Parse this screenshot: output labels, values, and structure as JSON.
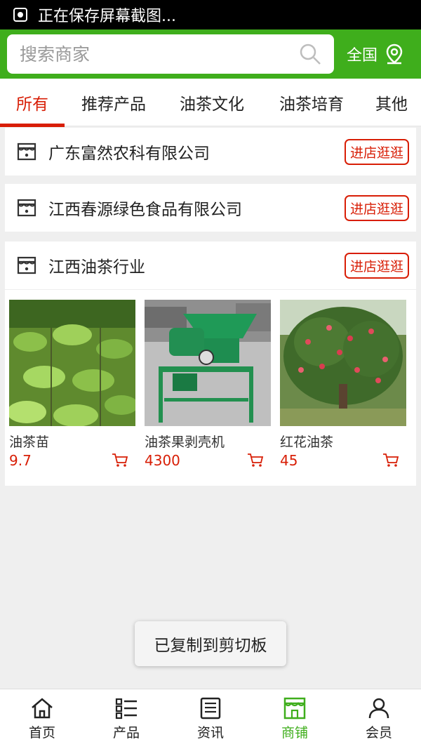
{
  "status": {
    "text": "正在保存屏幕截图..."
  },
  "search": {
    "placeholder": "搜索商家",
    "region": "全国"
  },
  "tabs": [
    {
      "label": "所有"
    },
    {
      "label": "推荐产品"
    },
    {
      "label": "油茶文化"
    },
    {
      "label": "油茶培育"
    },
    {
      "label": "其他"
    }
  ],
  "stores": [
    {
      "name": "广东富然农科有限公司",
      "button": "进店逛逛"
    },
    {
      "name": "江西春源绿色食品有限公司",
      "button": "进店逛逛"
    },
    {
      "name": "江西油茶行业",
      "button": "进店逛逛"
    }
  ],
  "products": [
    {
      "name": "油茶苗",
      "price": "9.7"
    },
    {
      "name": "油茶果剥壳机",
      "price": "4300"
    },
    {
      "name": "红花油茶",
      "price": "45"
    }
  ],
  "toast": "已复制到剪切板",
  "nav": [
    {
      "label": "首页",
      "icon": "home-icon"
    },
    {
      "label": "产品",
      "icon": "list-icon"
    },
    {
      "label": "资讯",
      "icon": "news-icon"
    },
    {
      "label": "商铺",
      "icon": "store-icon"
    },
    {
      "label": "会员",
      "icon": "user-icon"
    }
  ],
  "colors": {
    "brand_green": "#3fae1c",
    "accent_red": "#d81e06"
  }
}
